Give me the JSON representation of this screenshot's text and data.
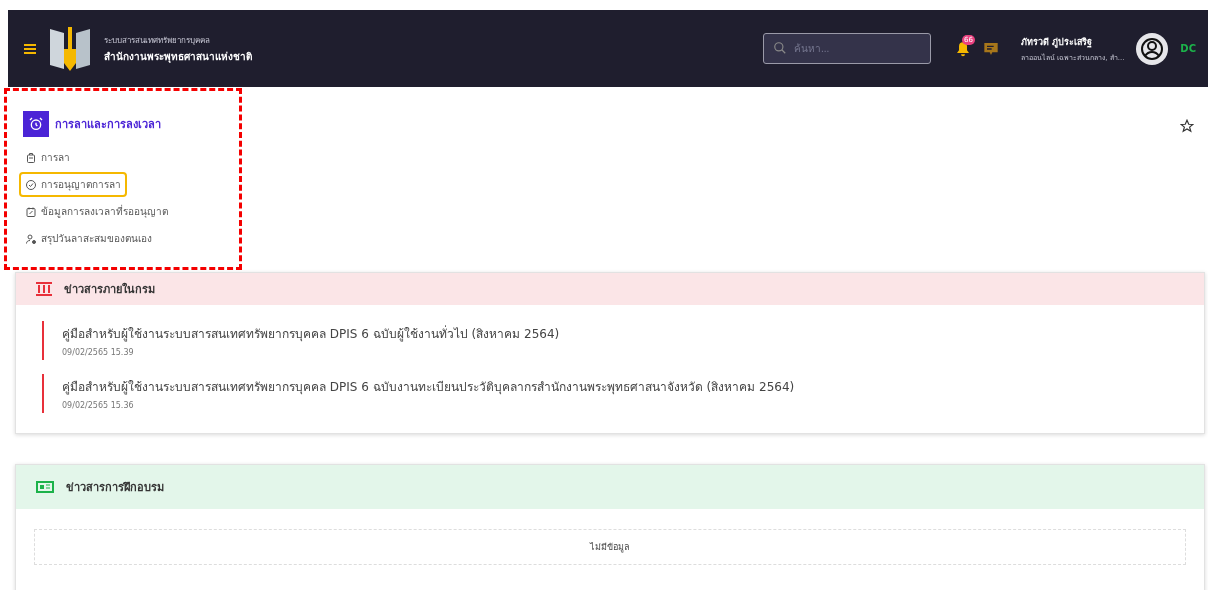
{
  "header": {
    "system_name": "ระบบสารสนเทศทรัพยากรบุคคล",
    "org_name": "สำนักงานพระพุทธศาสนาแห่งชาติ",
    "search": {
      "placeholder": "ค้นหา..."
    },
    "notification_count": "66",
    "user": {
      "name": "ภัทรวดี ภู่ประเสริฐ",
      "subtitle": "ลาออนไลน์ เฉพาะส่วนกลาง, สำ..."
    },
    "status_text": "DC"
  },
  "menu": {
    "title": "การลาและการลงเวลา",
    "items": [
      {
        "label": "การลา",
        "selected": false
      },
      {
        "label": "การอนุญาตการลา",
        "selected": true
      },
      {
        "label": "ข้อมูลการลงเวลาที่รออนุญาต",
        "selected": false
      },
      {
        "label": "สรุปวันลาสะสมของตนเอง",
        "selected": false
      }
    ]
  },
  "news": {
    "title": "ข่าวสารภายในกรม",
    "items": [
      {
        "title": "คู่มือสำหรับผู้ใช้งานระบบสารสนเทศทรัพยากรบุคคล DPIS 6 ฉบับผู้ใช้งานทั่วไป (สิงหาคม 2564)",
        "date": "09/02/2565 15.39"
      },
      {
        "title": "คู่มือสำหรับผู้ใช้งานระบบสารสนเทศทรัพยากรบุคคล DPIS 6 ฉบับงานทะเบียนประวัติบุคลากรสำนักงานพระพุทธศาสนาจังหวัด (สิงหาคม 2564)",
        "date": "09/02/2565 15.36"
      }
    ]
  },
  "training": {
    "title": "ข่าวสารการฝึกอบรม",
    "empty_text": "ไม่มีข้อมูล"
  }
}
